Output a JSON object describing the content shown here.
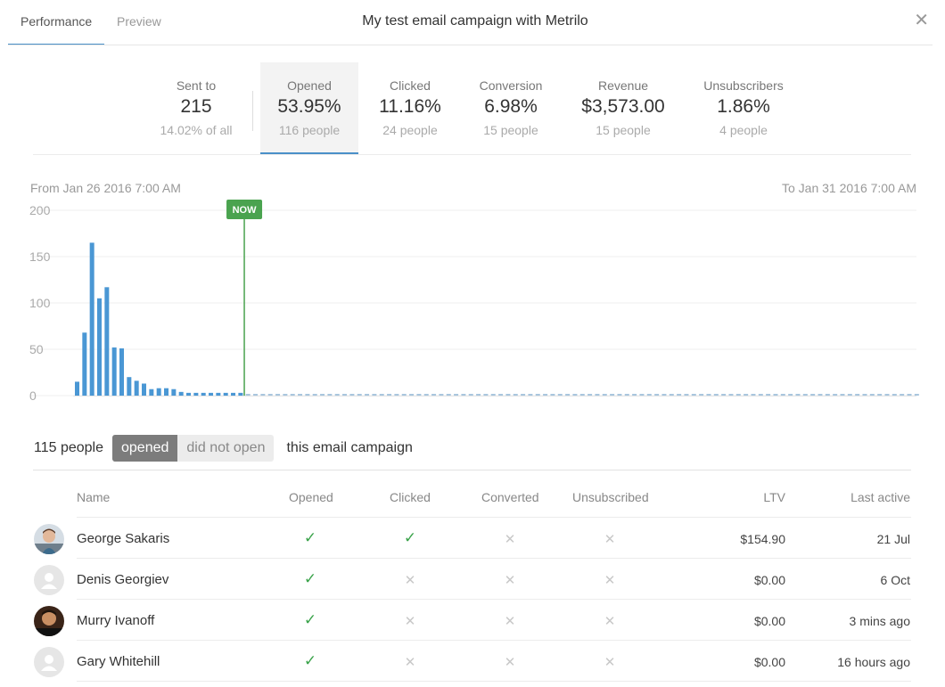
{
  "tabs": [
    {
      "label": "Performance",
      "active": true
    },
    {
      "label": "Preview",
      "active": false
    }
  ],
  "title": "My test email campaign with Metrilo",
  "close_icon": "close-icon",
  "stats": [
    {
      "label": "Sent to",
      "value": "215",
      "sub": "14.02% of all"
    },
    {
      "label": "Opened",
      "value": "53.95%",
      "sub": "116 people",
      "active": true
    },
    {
      "label": "Clicked",
      "value": "11.16%",
      "sub": "24 people"
    },
    {
      "label": "Conversion",
      "value": "6.98%",
      "sub": "15 people"
    },
    {
      "label": "Revenue",
      "value": "$3,573.00",
      "sub": "15 people"
    },
    {
      "label": "Unsubscribers",
      "value": "1.86%",
      "sub": "4 people"
    }
  ],
  "range": {
    "from": "From Jan 26 2016 7:00 AM",
    "to": "To Jan 31 2016 7:00 AM"
  },
  "chart_data": {
    "type": "bar",
    "y_ticks": [
      "200",
      "150",
      "100",
      "50",
      "0"
    ],
    "ylim": [
      0,
      200
    ],
    "values": [
      15,
      68,
      165,
      105,
      117,
      52,
      51,
      20,
      16,
      13,
      7,
      8,
      8,
      7,
      4,
      3,
      3,
      3,
      3,
      3,
      3,
      3,
      3
    ],
    "future_bins": 91,
    "now_index": 23,
    "now_label": "NOW",
    "bar_color": "#4a97d4",
    "now_color": "#4aa34f",
    "grid": true
  },
  "filter": {
    "count_text": "115 people",
    "opened_label": "opened",
    "not_open_label": "did not open",
    "suffix": "this email campaign"
  },
  "table": {
    "headers": {
      "name": "Name",
      "opened": "Opened",
      "clicked": "Clicked",
      "converted": "Converted",
      "unsubscribed": "Unsubscribed",
      "ltv": "LTV",
      "last_active": "Last active"
    },
    "rows": [
      {
        "name": "George Sakaris",
        "opened": true,
        "clicked": true,
        "converted": false,
        "unsubscribed": false,
        "ltv": "$154.90",
        "last_active": "21 Jul",
        "avatar": "photo"
      },
      {
        "name": "Denis Georgiev",
        "opened": true,
        "clicked": false,
        "converted": false,
        "unsubscribed": false,
        "ltv": "$0.00",
        "last_active": "6 Oct",
        "avatar": "placeholder"
      },
      {
        "name": "Murry Ivanoff",
        "opened": true,
        "clicked": false,
        "converted": false,
        "unsubscribed": false,
        "ltv": "$0.00",
        "last_active": "3 mins ago",
        "avatar": "photo"
      },
      {
        "name": "Gary Whitehill",
        "opened": true,
        "clicked": false,
        "converted": false,
        "unsubscribed": false,
        "ltv": "$0.00",
        "last_active": "16 hours ago",
        "avatar": "placeholder"
      }
    ]
  }
}
